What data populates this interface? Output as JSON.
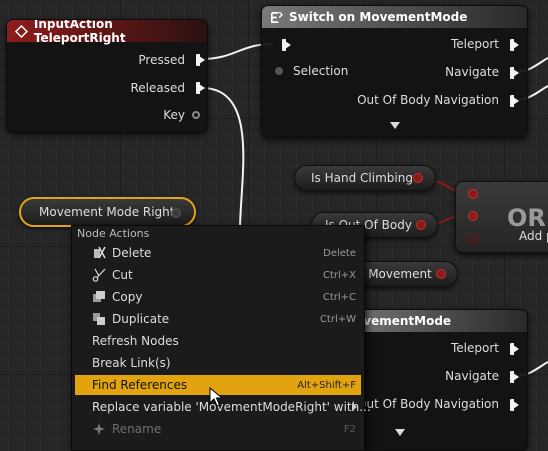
{
  "input_action_node": {
    "title": "InputAction TeleportRight",
    "pins": {
      "pressed": "Pressed",
      "released": "Released",
      "key": "Key"
    }
  },
  "switch_node_top": {
    "title": "Switch on MovementMode",
    "pins": {
      "selection": "Selection",
      "teleport": "Teleport",
      "navigate": "Navigate",
      "out_of_body": "Out Of Body Navigation"
    }
  },
  "switch_node_bottom": {
    "title_visible": "ovementMode",
    "pins": {
      "teleport": "Teleport",
      "navigate": "Navigate",
      "out_of_body": "Out Of Body Navigation"
    }
  },
  "variables": {
    "is_hand_climbing": "Is Hand Climbing",
    "is_out_of_body": "Is Out Of Body",
    "movement_partial": "e Movement",
    "movement_mode_right": "Movement Mode Right"
  },
  "or_node": {
    "label": "OR",
    "add_pin": "Add p"
  },
  "context_menu": {
    "heading": "Node Actions",
    "items": [
      {
        "label": "Delete",
        "shortcut": "Delete",
        "icon": "delete-icon"
      },
      {
        "label": "Cut",
        "shortcut": "Ctrl+X",
        "icon": "scissors-icon"
      },
      {
        "label": "Copy",
        "shortcut": "Ctrl+C",
        "icon": "copy-icon"
      },
      {
        "label": "Duplicate",
        "shortcut": "Ctrl+W",
        "icon": "duplicate-icon"
      },
      {
        "label": "Refresh Nodes",
        "shortcut": ""
      },
      {
        "label": "Break Link(s)",
        "shortcut": ""
      },
      {
        "label": "Find References",
        "shortcut": "Alt+Shift+F"
      },
      {
        "label": "Replace variable 'MovementModeRight' with...",
        "shortcut": ""
      },
      {
        "label": "Rename",
        "shortcut": "F2",
        "icon": "rename-icon"
      }
    ]
  },
  "colors": {
    "accent_highlight": "#e1a40f",
    "event_header": "#8e1d1d",
    "selection_outline": "#e3a318",
    "bool_pin": "#8b1a1a",
    "exec_wire": "#f2f2f2"
  }
}
